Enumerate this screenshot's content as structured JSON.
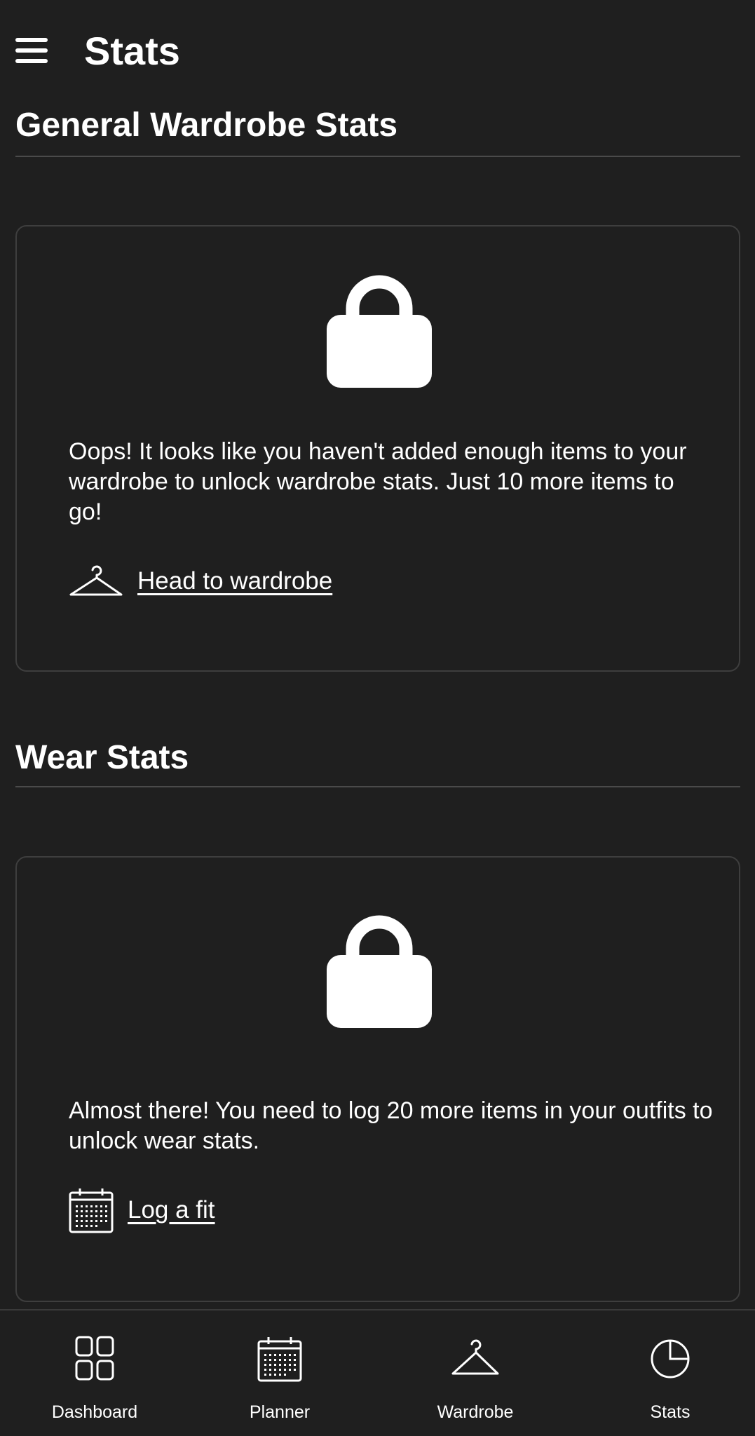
{
  "app_bar": {
    "title": "Stats",
    "menu_icon": "hamburger-menu-icon"
  },
  "sections": [
    {
      "title": "General Wardrobe Stats",
      "card": {
        "lock_icon": "lock-icon",
        "message": "Oops! It looks like you haven't added enough items to your wardrobe to unlock wardrobe stats. Just 10 more items to go!",
        "link_icon": "hanger-icon",
        "link_text": "Head to wardrobe"
      }
    },
    {
      "title": "Wear Stats",
      "card": {
        "lock_icon": "lock-icon",
        "message": "Almost there! You need to log 20 more items in your outfits to unlock wear stats.",
        "link_icon": "calendar-icon",
        "link_text": "Log a fit"
      }
    }
  ],
  "bottom_nav": [
    {
      "label": "Dashboard",
      "icon": "dashboard-grid-icon"
    },
    {
      "label": "Planner",
      "icon": "calendar-icon"
    },
    {
      "label": "Wardrobe",
      "icon": "hanger-icon"
    },
    {
      "label": "Stats",
      "icon": "pie-chart-icon"
    }
  ],
  "colors": {
    "background": "#1f1f1f",
    "text": "#ffffff",
    "divider": "#4a4a4a",
    "card_border": "#3e3e3e"
  }
}
